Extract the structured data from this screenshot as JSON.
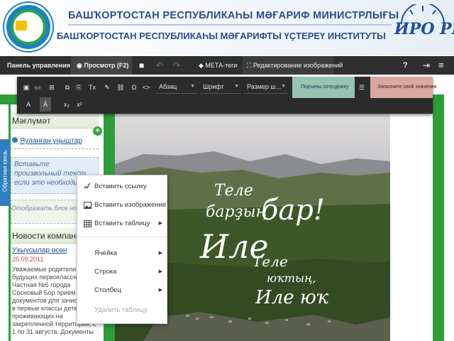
{
  "header": {
    "line1": "БАШҠОРТОСТАН РЕСПУБЛИКАҺЫ МӘҒАРИФ МИНИСТРЛЫҒЫ",
    "line2": "БАШҠОРТОСТАН РЕСПУБЛИКАҺЫ МӘҒАРИФТЫ ҮҪТЕРЕҮ ИНСТИТУТЫ",
    "brand": "ИРО РБ"
  },
  "adminbar": {
    "panel": "Панель управления",
    "preview": "Просмотр (F2)",
    "meta": "МЕТА-теги",
    "edit_image": "Редактирование изображений"
  },
  "toolbar": {
    "paragraph": "Абзац",
    "font": "Шрифт",
    "size": "Размер ш...",
    "employee_btn": "Подчины сотруднику",
    "fill_btn": "Заполните свой значения",
    "tools": [
      "▣",
      "▭",
      "⊞",
      "⧉",
      "⎘",
      "Tx",
      "✎",
      "⛓",
      "Ω",
      "<>"
    ],
    "tools2": [
      "A",
      "Ā",
      "x₂",
      "x²"
    ]
  },
  "sidebar": {
    "tab": "Обратная связь",
    "heading1": "Мәғлүмәт",
    "link1": "Яуланған уңыштар",
    "placeholder": "Вставьте произвольный текст, если это необходимо",
    "news_hint": "Отображать блок новостями: Да",
    "heading2": "Новости компании",
    "news_link": "Уҡыусылар өсөн",
    "news_date": "25.09.2011",
    "news_text": "Уважаемые родители будущих первоклассников, Частная №6 города Сосновый Бор прием документов для зачисления в первые классы детей, не проживающих на закрепленной территории, с 1 по 31 августа. Документы"
  },
  "photo": {
    "lettering": [
      "Теле",
      "барҙың",
      "Иле",
      "бар!",
      "Теле",
      "юҡтың,",
      "Иле юҡ"
    ]
  },
  "context_menu": {
    "items": [
      {
        "label": "Вставить ссылку",
        "icon": "link-icon",
        "submenu": false,
        "disabled": false
      },
      {
        "label": "Вставить изображение",
        "icon": "image-icon",
        "submenu": false,
        "disabled": false
      },
      {
        "label": "Вставить таблицу",
        "icon": "table-icon",
        "submenu": true,
        "disabled": false
      },
      {
        "label": "Ячейка",
        "icon": "",
        "submenu": true,
        "disabled": false
      },
      {
        "label": "Строка",
        "icon": "",
        "submenu": true,
        "disabled": false
      },
      {
        "label": "Столбец",
        "icon": "",
        "submenu": true,
        "disabled": false
      },
      {
        "label": "Удалить таблицу",
        "icon": "",
        "submenu": false,
        "disabled": true
      }
    ]
  },
  "colors": {
    "frame_green": "#2e9e3a",
    "admin_bar": "#2f2f2f",
    "header_text": "#2a4e8c"
  }
}
